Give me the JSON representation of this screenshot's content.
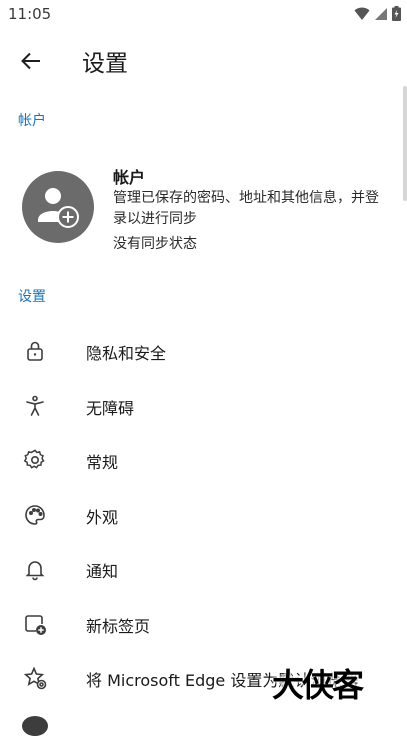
{
  "status_bar": {
    "time": "11:05"
  },
  "header": {
    "title": "设置"
  },
  "account_section": {
    "header": "帐户",
    "title": "帐户",
    "description": "管理已保存的密码、地址和其他信息，并登录以进行同步",
    "sync_status": "没有同步状态"
  },
  "settings_section": {
    "header": "设置",
    "items": [
      {
        "label": "隐私和安全",
        "icon": "lock-icon"
      },
      {
        "label": "无障碍",
        "icon": "accessibility-icon"
      },
      {
        "label": "常规",
        "icon": "gear-icon"
      },
      {
        "label": "外观",
        "icon": "palette-icon"
      },
      {
        "label": "通知",
        "icon": "bell-icon"
      },
      {
        "label": "新标签页",
        "icon": "new-tab-icon"
      },
      {
        "label": "将 Microsoft Edge 设置为默认浏览器",
        "icon": "star-gear-icon"
      }
    ]
  },
  "watermark": "大侠客",
  "colors": {
    "accent": "#1a73b8",
    "avatar_bg": "#6b6b6b",
    "icon": "#3d3d3d"
  }
}
